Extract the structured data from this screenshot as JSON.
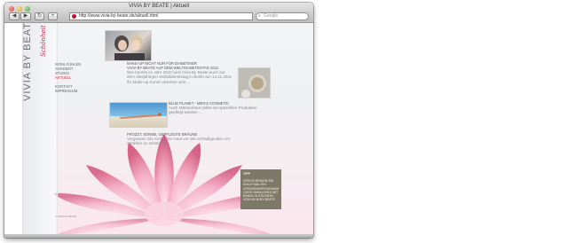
{
  "window": {
    "title": "VIVIA BY BEATE | Aktuell"
  },
  "browser": {
    "back": "◀",
    "forward": "▶",
    "reload": "↻",
    "add": "+",
    "url": "http://www.vivia-by-beate.de/aktuell.html",
    "search_placeholder": "Google"
  },
  "site": {
    "logo": "VIVIA BY BEATE",
    "logo_script": "Schönheit",
    "nav": [
      "WOHLFÜHLEN",
      "ANGEBOT",
      "STUDIO",
      "AKTUELL",
      "KONTAKT",
      "IMPRESSUM"
    ]
  },
  "articles": [
    {
      "head1": "MAKE-UP NICHT NUR FÜR DIABETIKER",
      "head2": "VIVIA BY BEATE AUF DEM WELTDIABETESTAG 2011",
      "body": "Wie bereits im Jahr 2010 wird Vivia By Beate auch auf dem diesjährigen Weltdiabetestag in Berlin am 14.11.2011 ihr Make-up Kunst vertreten sein ..."
    },
    {
      "head1": "BLUE PLANET - MEN'S COSMETIC",
      "body": "Auch Männerhaut sollte mit speziellen Produkten gepflegt werden ..."
    },
    {
      "head1": "FROZZT, SONNE, GEPFLEGTE BRÄUNE",
      "body": "Vergessen Sie nicht, Ihre Haut vor den schädigenden UV-Strahlen zu schützen! ..."
    }
  ],
  "tipp": {
    "title": "TIPP",
    "body": "VERSCHENKEN SIE DOCH MAL EIN VERWÖHNPROGRAMM ODER ÄHNLICHES MIT EINEM GUTSCHEIN VON VIVIA BY BEATE"
  },
  "footer": "© VIVIA BY BEATE",
  "colors": {
    "accent": "#c62a4f",
    "tipp_bg": "#7d7867"
  }
}
